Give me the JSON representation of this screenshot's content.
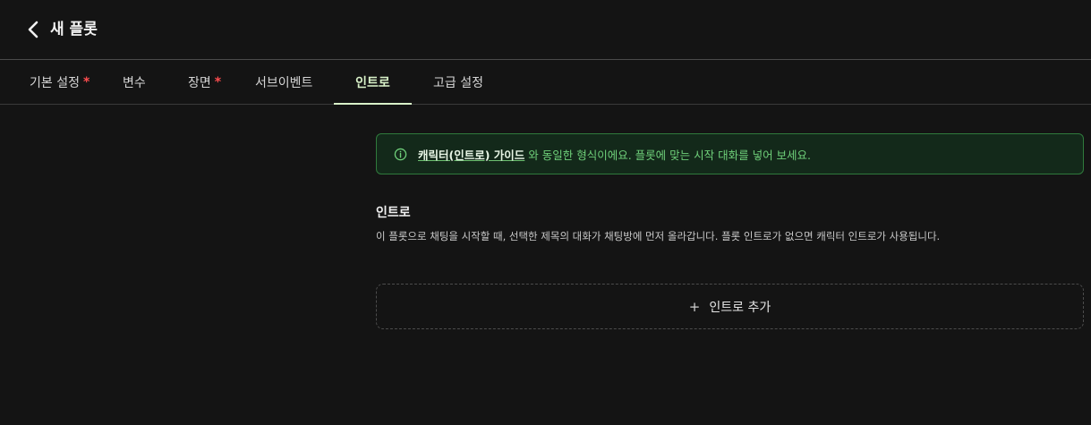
{
  "header": {
    "title": "새 플롯"
  },
  "tabs": [
    {
      "label": "기본 설정",
      "required": "*"
    },
    {
      "label": "변수",
      "required": ""
    },
    {
      "label": "장면",
      "required": "*"
    },
    {
      "label": "서브이벤트",
      "required": ""
    },
    {
      "label": "인트로",
      "required": ""
    },
    {
      "label": "고급 설정",
      "required": ""
    }
  ],
  "active_tab": "인트로",
  "notice": {
    "link_text": "캐릭터(인트로) 가이드",
    "text": "와 동일한 형식이에요. 플롯에 맞는 시작 대화를 넣어 보세요."
  },
  "intro_section": {
    "title": "인트로",
    "description": "이 플롯으로 채팅을 시작할 때, 선택한 제목의 대화가 채팅방에 먼저 올라갑니다. 플롯 인트로가 없으면 캐릭터 인트로가 사용됩니다."
  },
  "add_button": {
    "icon": "+",
    "label": "인트로 추가"
  },
  "colors": {
    "background": "#141414",
    "accent": "#d9f2c9",
    "required": "#ff4d4f",
    "notice_text": "#6fd07a",
    "notice_border": "#2f7a3c"
  }
}
